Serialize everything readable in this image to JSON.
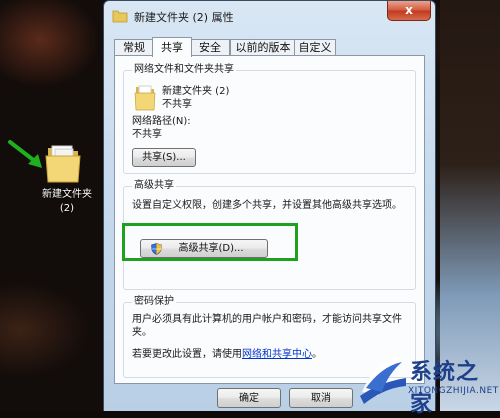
{
  "desktop": {
    "icon_label_line1": "新建文件夹",
    "icon_label_line2": "(2)"
  },
  "window": {
    "title": "新建文件夹 (2) 属性",
    "close_glyph": "x",
    "tabs": [
      {
        "label": "常规"
      },
      {
        "label": "共享",
        "active": true
      },
      {
        "label": "安全"
      },
      {
        "label": "以前的版本"
      },
      {
        "label": "自定义"
      }
    ],
    "network_sharing": {
      "title": "网络文件和文件夹共享",
      "folder_name": "新建文件夹 (2)",
      "folder_status": "不共享",
      "path_label": "网络路径(N):",
      "path_value": "不共享",
      "share_button": "共享(S)..."
    },
    "advanced_sharing": {
      "title": "高级共享",
      "description": "设置自定义权限，创建多个共享，并设置其他高级共享选项。",
      "button": "高级共享(D)..."
    },
    "password_protection": {
      "title": "密码保护",
      "description": "用户必须具有此计算机的用户帐户和密码，才能访问共享文件夹。",
      "change_text": "若要更改此设置，请使用",
      "link": "网络和共享中心",
      "suffix": "。"
    },
    "ok_button": "确定",
    "cancel_button": "取消"
  },
  "watermark": {
    "cn": "系统之家",
    "en": "XITONGZHIJIA.NET"
  },
  "colors": {
    "highlight_green": "#1fa01f",
    "link_blue": "#0033cc",
    "watermark_blue": "#1e3f8a"
  }
}
